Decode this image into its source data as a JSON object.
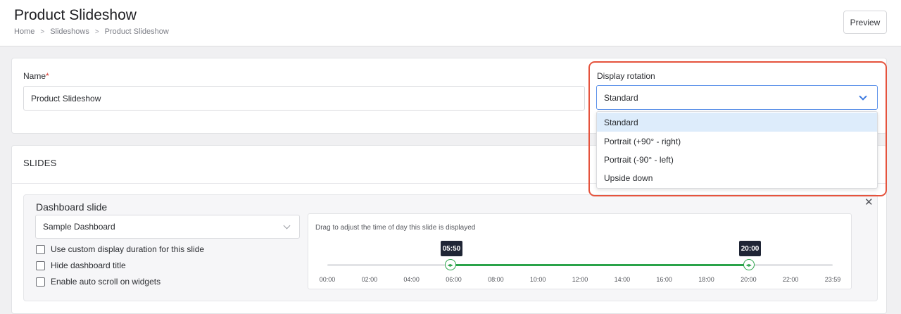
{
  "header": {
    "title": "Product Slideshow",
    "breadcrumb": [
      "Home",
      "Slideshows",
      "Product Slideshow"
    ],
    "preview_label": "Preview"
  },
  "name_field": {
    "label": "Name",
    "required_mark": "*",
    "value": "Product Slideshow"
  },
  "display_rotation": {
    "label": "Display rotation",
    "selected": "Standard",
    "options": [
      "Standard",
      "Portrait (+90° - right)",
      "Portrait (-90° - left)",
      "Upside down"
    ],
    "highlight_color": "#e5533d"
  },
  "slides": {
    "section_title": "SLIDES",
    "items": [
      {
        "title": "Dashboard slide",
        "dashboard": "Sample Dashboard",
        "options": [
          {
            "label": "Use custom display duration for this slide",
            "checked": false
          },
          {
            "label": "Hide dashboard title",
            "checked": false
          },
          {
            "label": "Enable auto scroll on widgets",
            "checked": false
          }
        ],
        "timeline": {
          "hint": "Drag to adjust the time of day this slide is displayed",
          "start": "05:50",
          "end": "20:00",
          "ticks": [
            "00:00",
            "02:00",
            "04:00",
            "06:00",
            "08:00",
            "10:00",
            "12:00",
            "14:00",
            "16:00",
            "18:00",
            "20:00",
            "22:00",
            "23:59"
          ],
          "range_color": "#2aa34a"
        }
      }
    ]
  }
}
